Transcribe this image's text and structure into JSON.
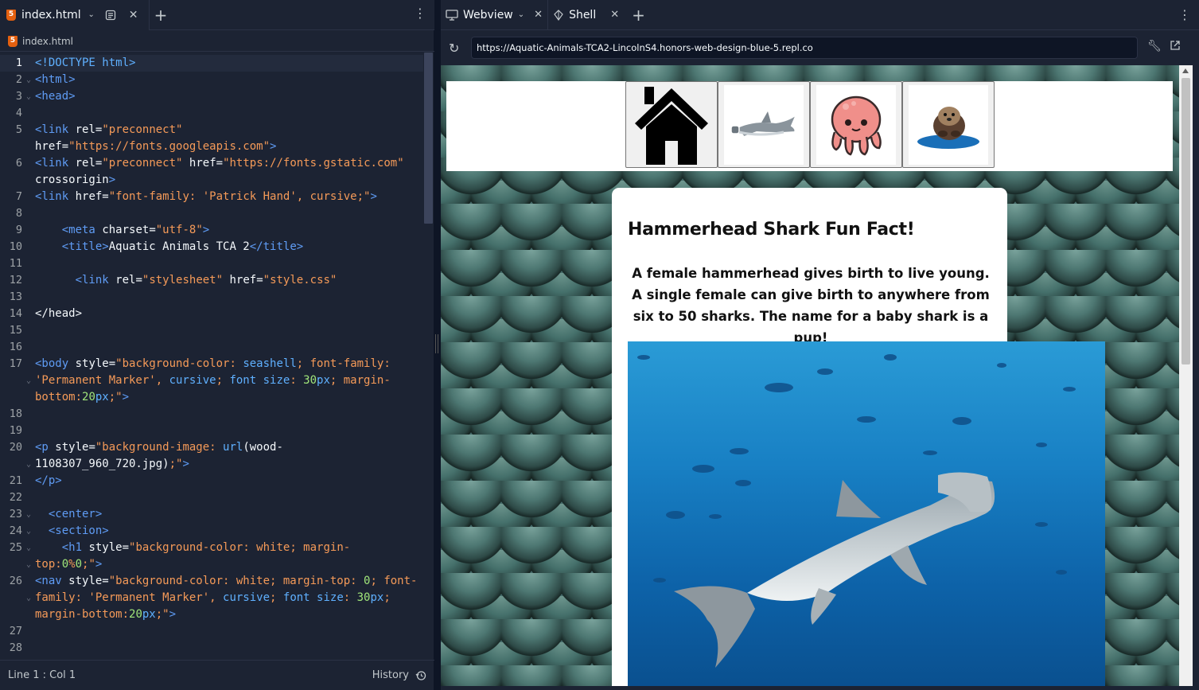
{
  "editor": {
    "tab_label": "index.html",
    "breadcrumb": "index.html",
    "status_position": "Line 1 : Col 1",
    "history_label": "History",
    "lines": [
      {
        "n": "1",
        "fold": false,
        "html": "<span class='kw'>&lt;!DOCTYPE html&gt;</span>"
      },
      {
        "n": "2",
        "fold": true,
        "html": "<span class='tag'>&lt;html&gt;</span>"
      },
      {
        "n": "3",
        "fold": true,
        "html": "<span class='tag'>&lt;head&gt;</span>"
      },
      {
        "n": "4",
        "fold": false,
        "html": ""
      },
      {
        "n": "5",
        "fold": false,
        "html": "<span class='tag'>&lt;link</span> <span class='attr'>rel=</span><span class='str'>\"preconnect\"</span>"
      },
      {
        "n": "",
        "fold": false,
        "html": "<span class='attr'>href=</span><span class='str'>\"https://fonts.googleapis.com\"</span><span class='tag'>&gt;</span>"
      },
      {
        "n": "6",
        "fold": false,
        "html": "<span class='tag'>&lt;link</span> <span class='attr'>rel=</span><span class='str'>\"preconnect\"</span> <span class='attr'>href=</span><span class='str'>\"https://fonts.gstatic.com\"</span>"
      },
      {
        "n": "",
        "fold": false,
        "html": "<span class='attr'>crossorigin</span><span class='tag'>&gt;</span>"
      },
      {
        "n": "7",
        "fold": false,
        "html": "<span class='tag'>&lt;link</span> <span class='attr'>href=</span><span class='str'>\"font-family: 'Patrick Hand', cursive;\"</span><span class='tag'>&gt;</span>"
      },
      {
        "n": "8",
        "fold": false,
        "html": ""
      },
      {
        "n": "9",
        "fold": false,
        "html": "    <span class='tag'>&lt;meta</span> <span class='attr'>charset=</span><span class='str'>\"utf-8\"</span><span class='tag'>&gt;</span>"
      },
      {
        "n": "10",
        "fold": false,
        "html": "    <span class='tag'>&lt;title&gt;</span>Aquatic Animals TCA 2<span class='tag'>&lt;/title&gt;</span>"
      },
      {
        "n": "11",
        "fold": false,
        "html": ""
      },
      {
        "n": "12",
        "fold": false,
        "html": "      <span class='tag'>&lt;link</span> <span class='attr'>rel=</span><span class='str'>\"stylesheet\"</span> <span class='attr'>href=</span><span class='str'>\"style.css\"</span>"
      },
      {
        "n": "13",
        "fold": false,
        "html": ""
      },
      {
        "n": "14",
        "fold": false,
        "html": "<span class='attr'>&lt;/head&gt;</span>"
      },
      {
        "n": "15",
        "fold": false,
        "html": ""
      },
      {
        "n": "16",
        "fold": false,
        "html": ""
      },
      {
        "n": "17",
        "fold": false,
        "html": "<span class='tag'>&lt;body</span> <span class='attr'>style=</span><span class='str'>\"background-color: </span><span class='kw'>seashell</span><span class='str'>; font-family:</span>"
      },
      {
        "n": "",
        "fold": true,
        "html": "<span class='str'>'Permanent Marker'</span><span class='str'>, </span><span class='kw'>cursive</span><span class='str'>; </span><span class='kw'>font size</span><span class='str'>: </span><span class='num'>30</span><span class='kw'>px</span><span class='str'>; margin-</span>"
      },
      {
        "n": "",
        "fold": false,
        "html": "<span class='str'>bottom:</span><span class='num'>20</span><span class='kw'>px</span><span class='str'>;\"</span><span class='tag'>&gt;</span>"
      },
      {
        "n": "18",
        "fold": false,
        "html": ""
      },
      {
        "n": "19",
        "fold": false,
        "html": ""
      },
      {
        "n": "20",
        "fold": false,
        "html": "<span class='tag'>&lt;p</span> <span class='attr'>style=</span><span class='str'>\"background-image: </span><span class='kw'>url</span><span class='attr'>(wood-</span>"
      },
      {
        "n": "",
        "fold": true,
        "html": "<span class='attr'>1108307_960_720.jpg)</span><span class='str'>;\"</span><span class='tag'>&gt;</span>"
      },
      {
        "n": "21",
        "fold": false,
        "html": "<span class='tag'>&lt;/p&gt;</span>"
      },
      {
        "n": "22",
        "fold": false,
        "html": ""
      },
      {
        "n": "23",
        "fold": true,
        "html": "  <span class='tag'>&lt;center&gt;</span>"
      },
      {
        "n": "24",
        "fold": true,
        "html": "  <span class='tag'>&lt;section&gt;</span>"
      },
      {
        "n": "25",
        "fold": true,
        "html": "    <span class='tag'>&lt;h1</span> <span class='attr'>style=</span><span class='str'>\"background-color: white; margin-</span>"
      },
      {
        "n": "",
        "fold": true,
        "html": "<span class='str'>top:</span><span class='num'>0</span><span class='str'>%</span><span class='num'>0</span><span class='str'>;\"</span><span class='tag'>&gt;</span>"
      },
      {
        "n": "26",
        "fold": false,
        "html": "<span class='tag'>&lt;nav</span> <span class='attr'>style=</span><span class='str'>\"background-color: white; margin-top: </span><span class='num'>0</span><span class='str'>; font-</span>"
      },
      {
        "n": "",
        "fold": true,
        "html": "<span class='str'>family: 'Permanent Marker', </span><span class='kw'>cursive</span><span class='str'>; </span><span class='kw'>font size</span><span class='str'>: </span><span class='num'>30</span><span class='kw'>px</span><span class='str'>;</span>"
      },
      {
        "n": "",
        "fold": false,
        "html": "<span class='str'>margin-bottom:</span><span class='num'>20</span><span class='kw'>px</span><span class='str'>;\"</span><span class='tag'>&gt;</span>"
      },
      {
        "n": "27",
        "fold": false,
        "html": ""
      },
      {
        "n": "28",
        "fold": false,
        "html": ""
      }
    ]
  },
  "webview": {
    "tab_label": "Webview",
    "shell_tab_label": "Shell",
    "url": "https://Aquatic-Animals-TCA2-LincolnS4.honors-web-design-blue-5.repl.co",
    "nav_buttons": [
      {
        "name": "home",
        "icon": "house-icon"
      },
      {
        "name": "shark",
        "icon": "shark-sticker-icon"
      },
      {
        "name": "octopus",
        "icon": "octopus-sticker-icon"
      },
      {
        "name": "otter",
        "icon": "otter-sticker-icon"
      }
    ],
    "card": {
      "title": "Hammerhead Shark Fun Fact!",
      "body": "A female hammerhead gives birth to live young. A single female can give birth to anywhere from six to 50 sharks. The name for a baby shark is a pup!"
    }
  },
  "colors": {
    "ide_bg": "#1c2333",
    "accent": "#5f9cf5",
    "string": "#f59a58",
    "number": "#a0e57a"
  }
}
